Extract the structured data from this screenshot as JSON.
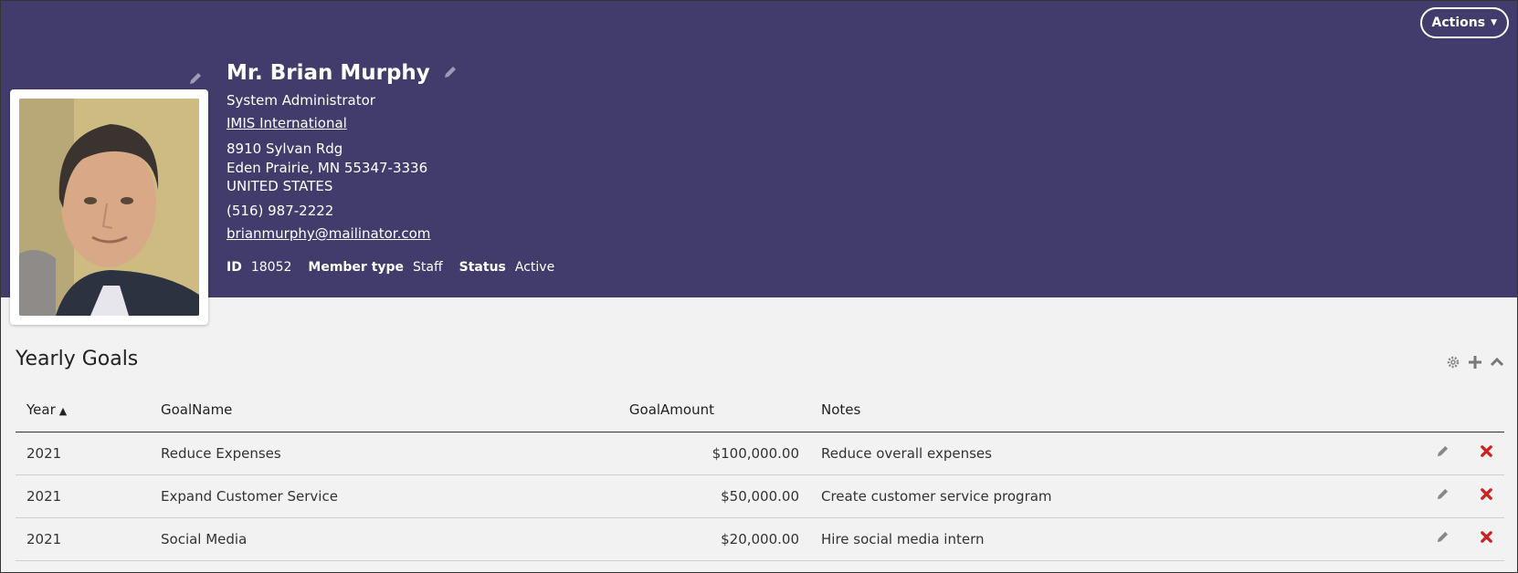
{
  "header": {
    "actions_label": "Actions",
    "name": "Mr. Brian Murphy",
    "title": "System Administrator",
    "organization": "IMIS International",
    "address_line1": "8910 Sylvan Rdg",
    "address_line2": "Eden Prairie, MN 55347-3336",
    "country": "UNITED STATES",
    "phone": "(516) 987-2222",
    "email": "brianmurphy@mailinator.com",
    "meta": {
      "id_label": "ID",
      "id_value": "18052",
      "member_type_label": "Member type",
      "member_type_value": "Staff",
      "status_label": "Status",
      "status_value": "Active"
    },
    "colors": {
      "background": "#413c6b",
      "text": "#ffffff"
    }
  },
  "section": {
    "title": "Yearly Goals",
    "tools": [
      "gear-icon",
      "plus-icon",
      "chevron-up-icon"
    ]
  },
  "table": {
    "columns": {
      "year": "Year",
      "goal_name": "GoalName",
      "goal_amount": "GoalAmount",
      "notes": "Notes"
    },
    "sorted_column": "year",
    "sort_direction": "ascending",
    "rows": [
      {
        "year": "2021",
        "goal_name": "Reduce Expenses",
        "goal_amount": "$100,000.00",
        "notes": "Reduce overall expenses"
      },
      {
        "year": "2021",
        "goal_name": "Expand Customer Service",
        "goal_amount": "$50,000.00",
        "notes": "Create customer service program"
      },
      {
        "year": "2021",
        "goal_name": "Social Media",
        "goal_amount": "$20,000.00",
        "notes": "Hire social media intern"
      }
    ],
    "row_action_icons": [
      "pencil-icon",
      "delete-x-icon"
    ],
    "delete_color": "#cc2222"
  }
}
